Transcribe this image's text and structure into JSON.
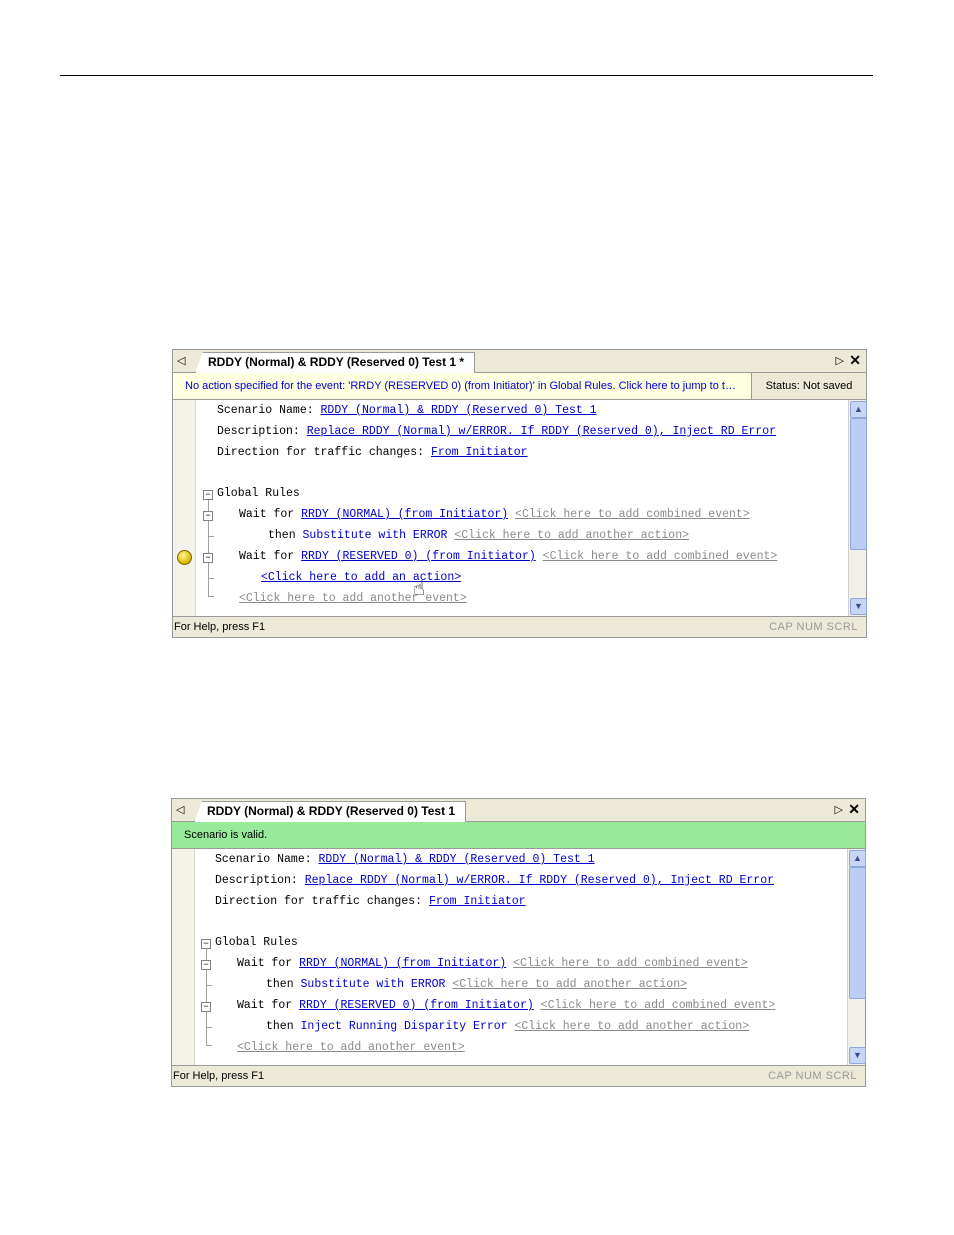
{
  "window1": {
    "tab_title": "RDDY (Normal) & RDDY (Reserved 0) Test 1 *",
    "message": "No action specified for the event: 'RRDY (RESERVED 0) (from Initiator)' in Global Rules.  Click here to jump to t…",
    "status": "Status: Not saved",
    "lines": {
      "scenario_label": "Scenario Name:",
      "scenario_value": "RDDY (Normal) & RDDY (Reserved 0) Test 1",
      "desc_label": "Description:",
      "desc_value": "Replace RDDY (Normal) w/ERROR. If RDDY (Reserved 0), Inject RD Error",
      "dir_label": "Direction for traffic changes:",
      "dir_value": "From Initiator",
      "global_rules": "Global Rules",
      "wait1": "Wait for",
      "event1": "RRDY (NORMAL) (from Initiator)",
      "combined1": "<Click here to add combined event>",
      "then1": "then",
      "action1": "Substitute with ERROR",
      "another_action1": "<Click here to add another action>",
      "wait2": "Wait for",
      "event2": "RRDY (RESERVED 0) (from Initiator)",
      "combined2": "<Click here to add combined event>",
      "add_action": "<Click here to add an action>",
      "another_event": "<Click here to add another event>"
    },
    "help": "For Help, press F1",
    "indicators": "CAP  NUM  SCRL"
  },
  "window2": {
    "tab_title": "RDDY (Normal) & RDDY (Reserved 0) Test 1",
    "message": "Scenario is valid.",
    "lines": {
      "scenario_label": "Scenario Name:",
      "scenario_value": "RDDY (Normal) & RDDY (Reserved 0) Test 1",
      "desc_label": "Description:",
      "desc_value": "Replace RDDY (Normal) w/ERROR. If RDDY (Reserved 0), Inject RD Error",
      "dir_label": "Direction for traffic changes:",
      "dir_value": "From Initiator",
      "global_rules": "Global Rules",
      "wait1": "Wait for",
      "event1": "RRDY (NORMAL) (from Initiator)",
      "combined1": "<Click here to add combined event>",
      "then1": "then",
      "action1": "Substitute with ERROR",
      "another_action1": "<Click here to add another action>",
      "wait2": "Wait for",
      "event2": "RRDY (RESERVED 0) (from Initiator)",
      "combined2": "<Click here to add combined event>",
      "then2": "then",
      "action2": "Inject Running Disparity Error",
      "another_action2": "<Click here to add another action>",
      "another_event": "<Click here to add another event>"
    },
    "help": "For Help, press F1",
    "indicators": "CAP  NUM  SCRL"
  },
  "icons": {
    "tab_left": "◁",
    "tab_right": "▷",
    "close": "✕",
    "scroll_up": "▲",
    "scroll_down": "▼",
    "collapse": "−",
    "hand_cursor": "☝"
  }
}
